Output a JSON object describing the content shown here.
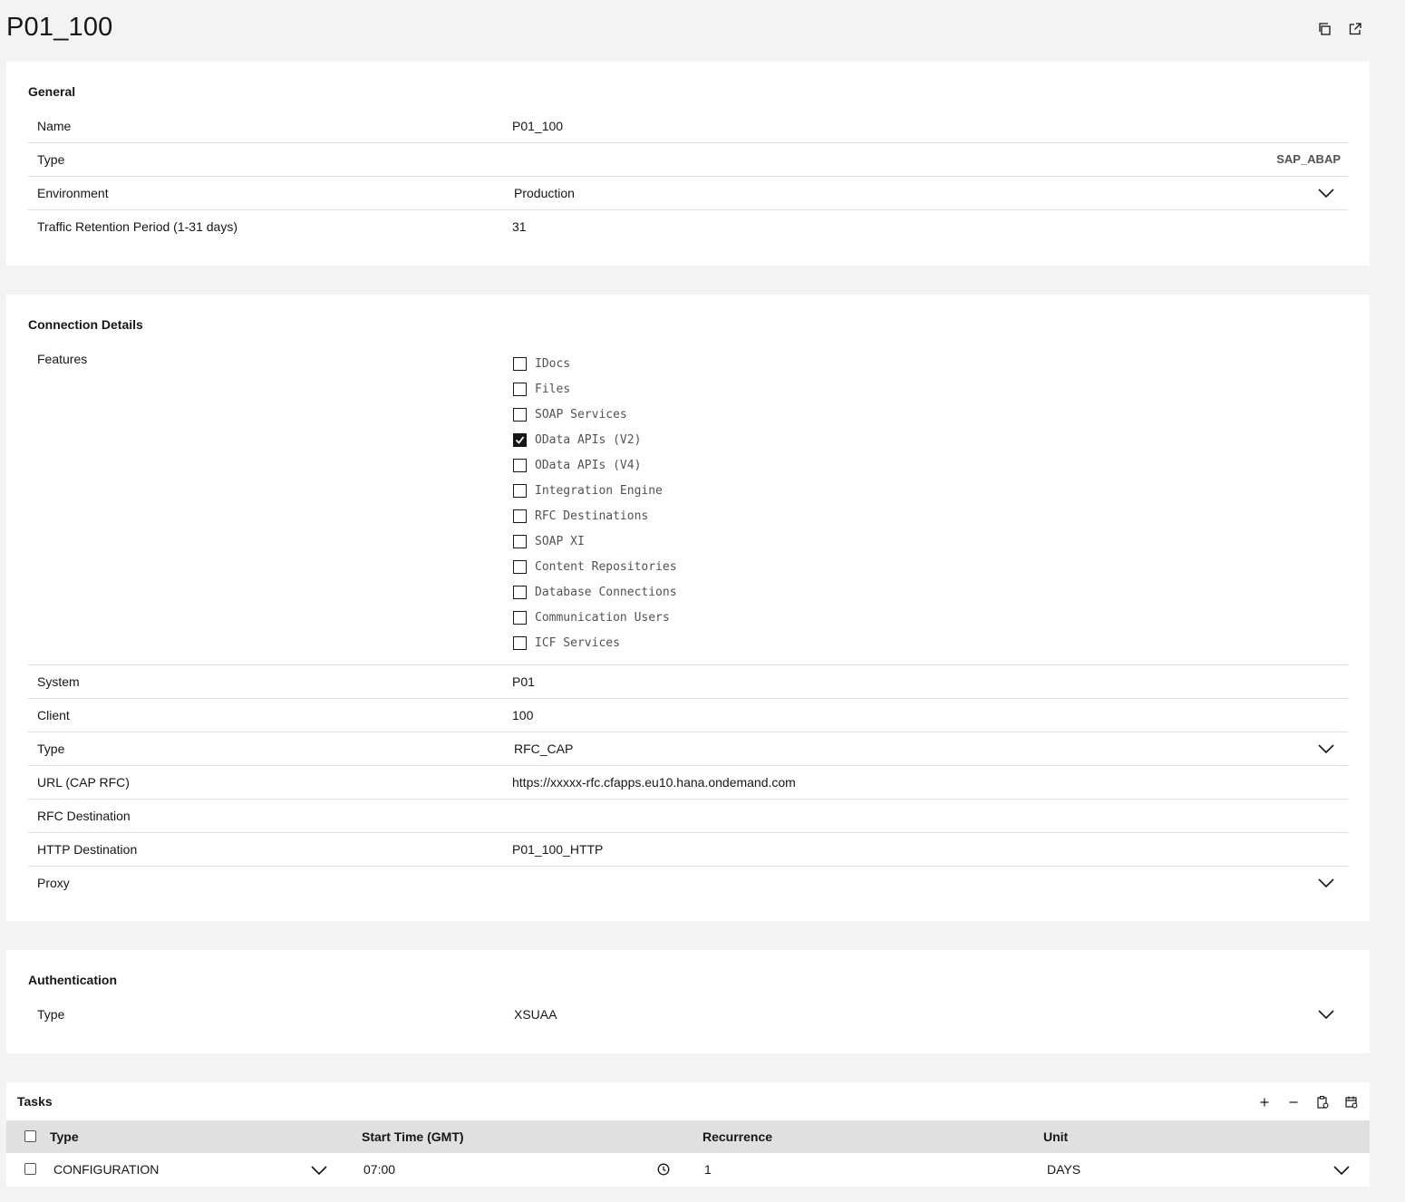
{
  "page": {
    "title": "P01_100"
  },
  "general": {
    "title": "General",
    "rows": {
      "name": {
        "label": "Name",
        "value": "P01_100"
      },
      "type": {
        "label": "Type",
        "value": "SAP_ABAP"
      },
      "environment": {
        "label": "Environment",
        "value": "Production"
      },
      "retention": {
        "label": "Traffic Retention Period (1-31 days)",
        "value": "31"
      }
    }
  },
  "connection": {
    "title": "Connection Details",
    "features_label": "Features",
    "features": [
      {
        "label": "IDocs",
        "checked": false
      },
      {
        "label": "Files",
        "checked": false
      },
      {
        "label": "SOAP Services",
        "checked": false
      },
      {
        "label": "OData APIs (V2)",
        "checked": true
      },
      {
        "label": "OData APIs (V4)",
        "checked": false
      },
      {
        "label": "Integration Engine",
        "checked": false
      },
      {
        "label": "RFC Destinations",
        "checked": false
      },
      {
        "label": "SOAP XI",
        "checked": false
      },
      {
        "label": "Content Repositories",
        "checked": false
      },
      {
        "label": "Database Connections",
        "checked": false
      },
      {
        "label": "Communication Users",
        "checked": false
      },
      {
        "label": "ICF Services",
        "checked": false
      }
    ],
    "rows": {
      "system": {
        "label": "System",
        "value": "P01"
      },
      "client": {
        "label": "Client",
        "value": "100"
      },
      "type": {
        "label": "Type",
        "value": "RFC_CAP"
      },
      "url": {
        "label": "URL (CAP RFC)",
        "value": "https://xxxxx-rfc.cfapps.eu10.hana.ondemand.com"
      },
      "rfc_destination": {
        "label": "RFC Destination",
        "value": ""
      },
      "http_destination": {
        "label": "HTTP Destination",
        "value": "P01_100_HTTP"
      },
      "proxy": {
        "label": "Proxy",
        "value": ""
      }
    }
  },
  "authentication": {
    "title": "Authentication",
    "type": {
      "label": "Type",
      "value": "XSUAA"
    }
  },
  "tasks": {
    "title": "Tasks",
    "columns": {
      "type": "Type",
      "start_time": "Start Time (GMT)",
      "recurrence": "Recurrence",
      "unit": "Unit"
    },
    "rows": [
      {
        "type": "CONFIGURATION",
        "start_time": "07:00",
        "recurrence": "1",
        "unit": "DAYS"
      }
    ]
  },
  "icons": [
    "copy-icon",
    "open-external-icon",
    "chevron-down-icon",
    "add-icon",
    "remove-icon",
    "clipboard-settings-icon",
    "calendar-settings-icon",
    "clock-icon",
    "checkmark-icon"
  ]
}
